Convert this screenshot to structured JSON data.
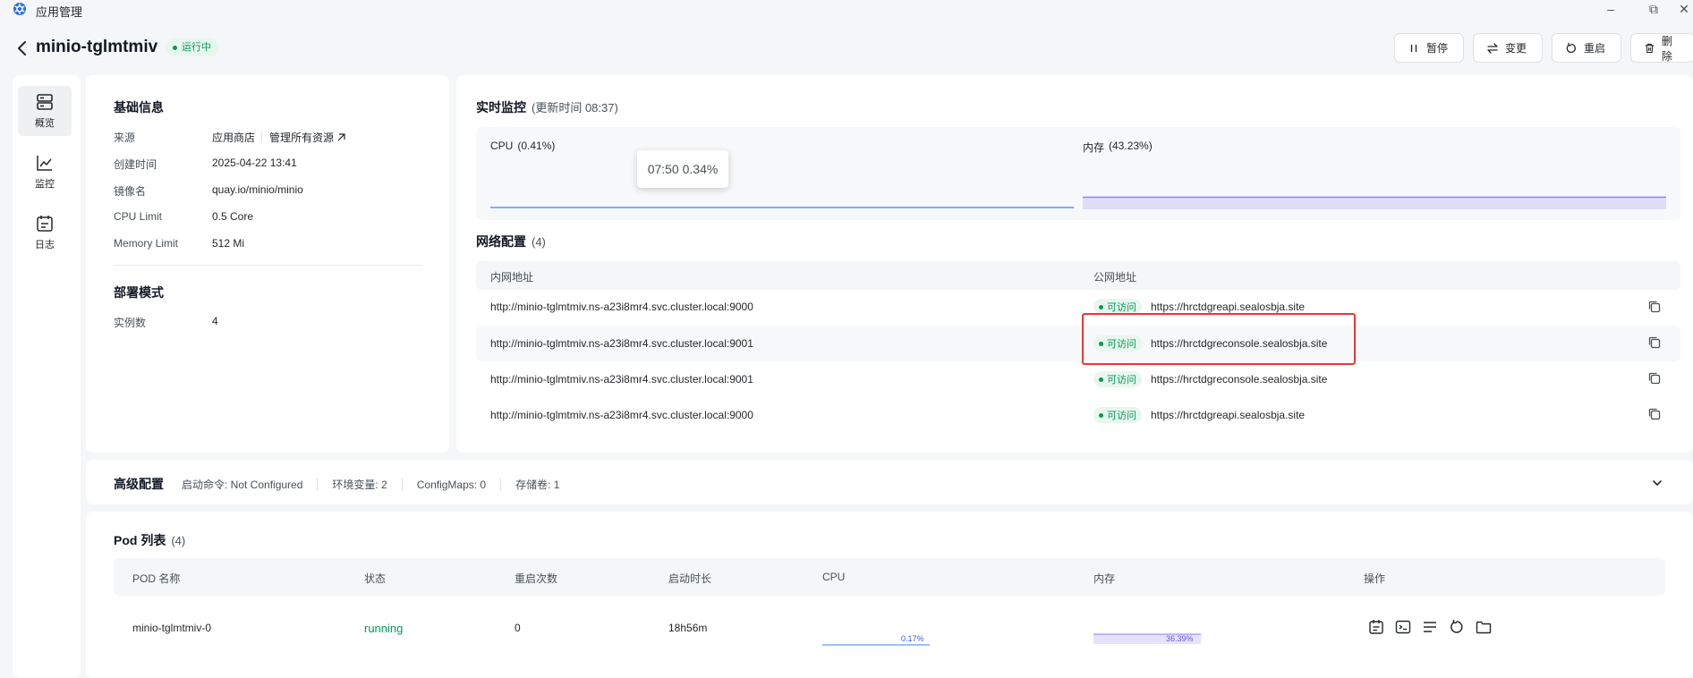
{
  "window": {
    "title": "应用管理",
    "minimize": "–",
    "restore": "⧉",
    "close": "✕"
  },
  "header": {
    "app_name": "minio-tglmtmiv",
    "status": "运行中",
    "buttons": {
      "pause": "暂停",
      "change": "变更",
      "restart": "重启",
      "delete": "删除"
    }
  },
  "sidebar": {
    "items": [
      {
        "label": "概览",
        "icon": "server-icon"
      },
      {
        "label": "监控",
        "icon": "chart-line-icon"
      },
      {
        "label": "日志",
        "icon": "calendar-log-icon"
      }
    ]
  },
  "basic_info": {
    "title": "基础信息",
    "rows": [
      {
        "label": "来源",
        "value": "应用商店",
        "extra": "管理所有资源"
      },
      {
        "label": "创建时间",
        "value": "2025-04-22 13:41"
      },
      {
        "label": "镜像名",
        "value": "quay.io/minio/minio"
      },
      {
        "label": "CPU Limit",
        "value": "0.5 Core"
      },
      {
        "label": "Memory Limit",
        "value": "512 Mi"
      }
    ],
    "deploy_title": "部署模式",
    "replicas_label": "实例数",
    "replicas_value": "4"
  },
  "monitor": {
    "title": "实时监控",
    "updated": "(更新时间  08:37)",
    "cpu_label": "CPU",
    "cpu_value": "(0.41%)",
    "mem_label": "内存",
    "mem_value": "(43.23%)",
    "tooltip": "07:50 0.34%",
    "cpu_percent": 0.41,
    "mem_percent": 43.23,
    "cpu_color": "#3b82f6",
    "mem_color": "#8b7cf6"
  },
  "network": {
    "title": "网络配置",
    "count": "(4)",
    "col_internal": "内网地址",
    "col_public": "公网地址",
    "access_label": "可访问",
    "rows": [
      {
        "internal": "http://minio-tglmtmiv.ns-a23i8mr4.svc.cluster.local:9000",
        "public": "https://hrctdgreapi.sealosbja.site"
      },
      {
        "internal": "http://minio-tglmtmiv.ns-a23i8mr4.svc.cluster.local:9001",
        "public": "https://hrctdgreconsole.sealosbja.site"
      },
      {
        "internal": "http://minio-tglmtmiv.ns-a23i8mr4.svc.cluster.local:9001",
        "public": "https://hrctdgreconsole.sealosbja.site"
      },
      {
        "internal": "http://minio-tglmtmiv.ns-a23i8mr4.svc.cluster.local:9000",
        "public": "https://hrctdgreapi.sealosbja.site"
      }
    ]
  },
  "advanced": {
    "title": "高级配置",
    "items": [
      "启动命令: Not Configured",
      "环境变量: 2",
      "ConfigMaps: 0",
      "存储卷: 1"
    ]
  },
  "pods": {
    "title": "Pod 列表",
    "count": "(4)",
    "columns": [
      "POD 名称",
      "状态",
      "重启次数",
      "启动时长",
      "CPU",
      "内存",
      "操作"
    ],
    "rows": [
      {
        "name": "minio-tglmtmiv-0",
        "status": "running",
        "restarts": "0",
        "uptime": "18h56m",
        "cpu": "0.17%",
        "mem": "36.39%"
      }
    ],
    "status_color": "#039855"
  }
}
